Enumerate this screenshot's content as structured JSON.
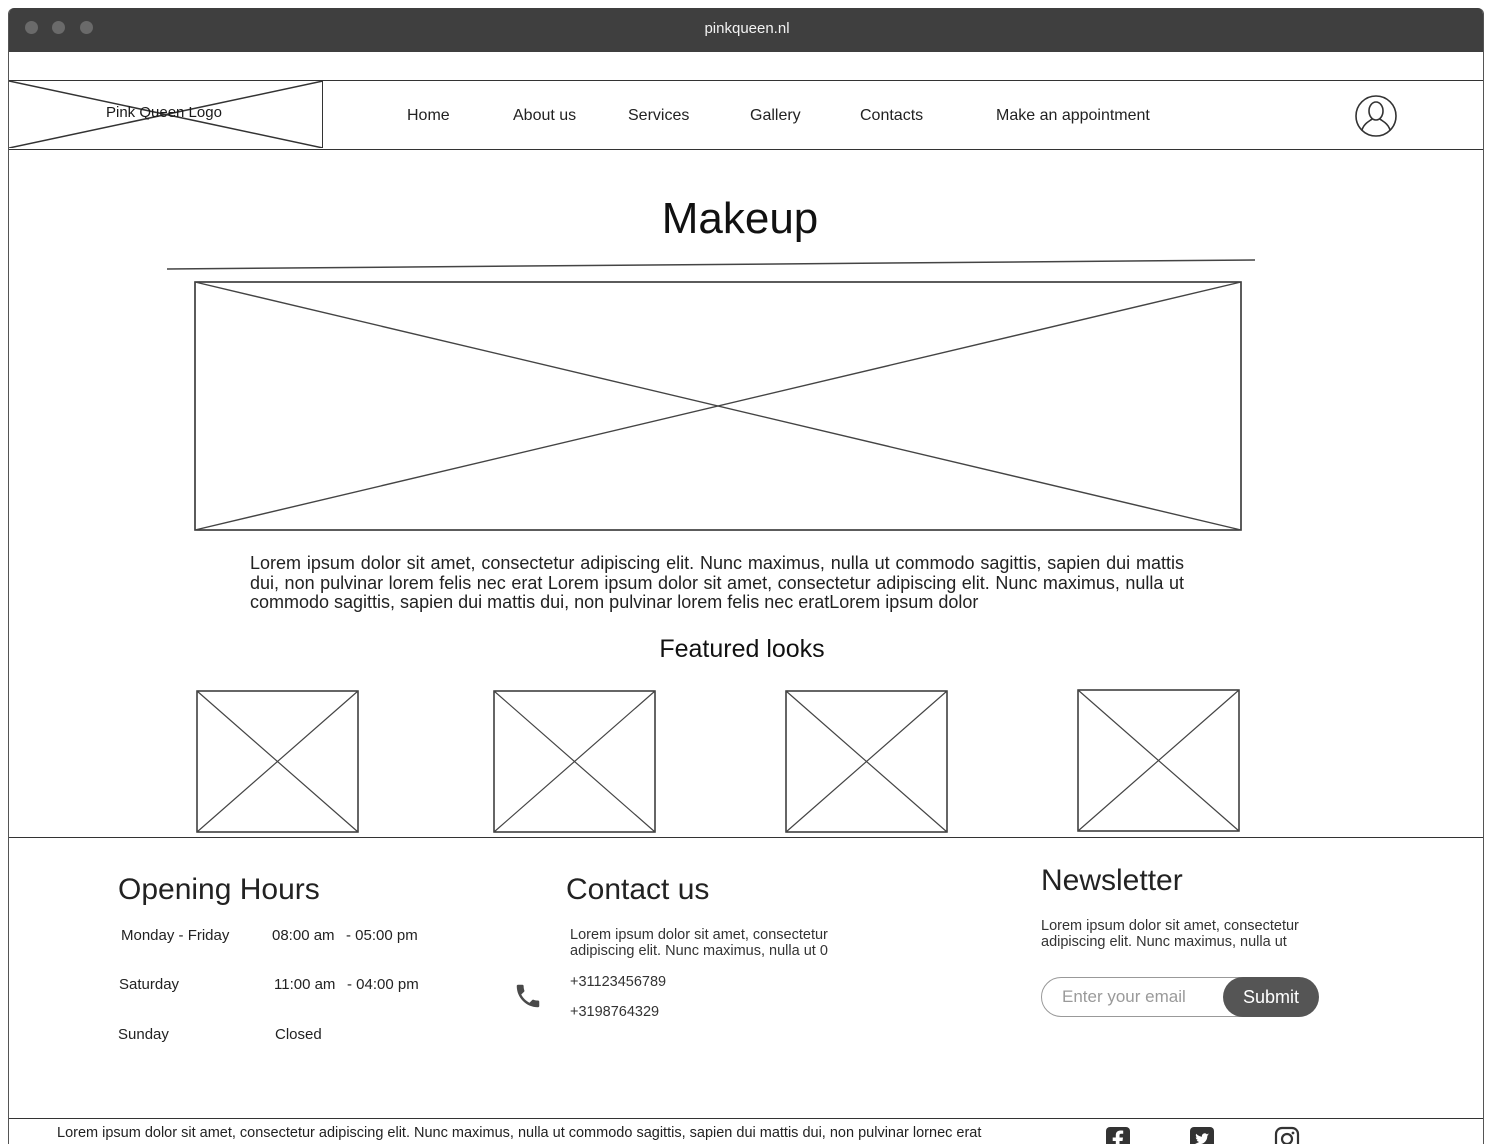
{
  "browser": {
    "url": "pinkqueen.nl"
  },
  "header": {
    "logo_text": "Pink Queen Logo",
    "nav": [
      "Home",
      "About us",
      "Services",
      "Gallery",
      "Contacts",
      "Make an appointment"
    ],
    "user_icon": "user-icon"
  },
  "main": {
    "title": "Makeup",
    "intro": "Lorem ipsum dolor sit amet, consectetur adipiscing elit. Nunc maximus, nulla ut commodo sagittis, sapien dui mattis dui, non pulvinar lorem felis nec erat Lorem ipsum dolor sit amet, consectetur adipiscing elit. Nunc maximus, nulla ut commodo sagittis, sapien dui mattis dui, non pulvinar lorem felis nec eratLorem ipsum dolor",
    "featured_heading": "Featured looks"
  },
  "footer": {
    "opening_hours": {
      "heading": "Opening Hours",
      "rows": [
        {
          "day": "Monday - Friday",
          "open": "08:00 am",
          "close": "- 05:00 pm"
        },
        {
          "day": "Saturday",
          "open": "11:00 am",
          "close": "- 04:00 pm"
        },
        {
          "day": "Sunday",
          "open": "Closed",
          "close": ""
        }
      ]
    },
    "contact": {
      "heading": "Contact us",
      "text_line1": "Lorem ipsum dolor sit amet, consectetur",
      "text_line2": "adipiscing elit. Nunc maximus, nulla ut 0",
      "phones": [
        "+31123456789",
        "+3198764329"
      ]
    },
    "newsletter": {
      "heading": "Newsletter",
      "text_line1": "Lorem ipsum dolor sit amet, consectetur",
      "text_line2": "adipiscing elit. Nunc maximus, nulla ut",
      "email_placeholder": "Enter your email",
      "submit_label": "Submit"
    },
    "bottom_text": "Lorem ipsum dolor sit amet, consectetur adipiscing elit. Nunc maximus, nulla ut commodo sagittis, sapien dui mattis dui, non pulvinar lornec erat",
    "social_icons": [
      "facebook-icon",
      "twitter-icon",
      "instagram-icon"
    ]
  }
}
